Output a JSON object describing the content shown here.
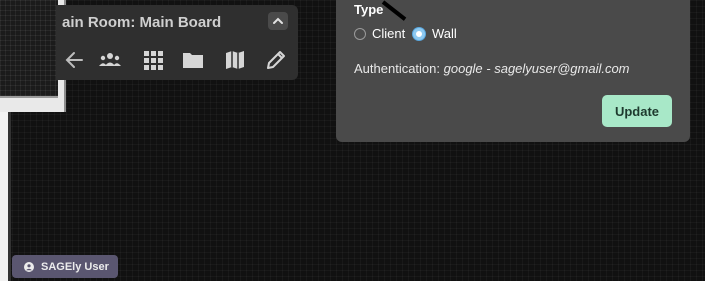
{
  "room_panel": {
    "title": "ain Room: Main Board",
    "toolbar_icons": [
      "back-arrow-icon",
      "users-icon",
      "apps-grid-icon",
      "folder-icon",
      "map-icon",
      "pencil-icon"
    ]
  },
  "dialog": {
    "type_label": "Type",
    "options": [
      "Client",
      "Wall"
    ],
    "selected": "Wall",
    "auth_label": "Authentication: ",
    "auth_value": "google - sagelyuser@gmail.com",
    "update_label": "Update"
  },
  "user_badge": {
    "label": "SAGEly User"
  },
  "colors": {
    "background": "#111111",
    "panel": "#2f2f2f",
    "dialog": "#4a4a4a",
    "update_button": "#a8e8c8",
    "radio_selected": "#8ec9f0",
    "user_badge": "#5a5670"
  }
}
